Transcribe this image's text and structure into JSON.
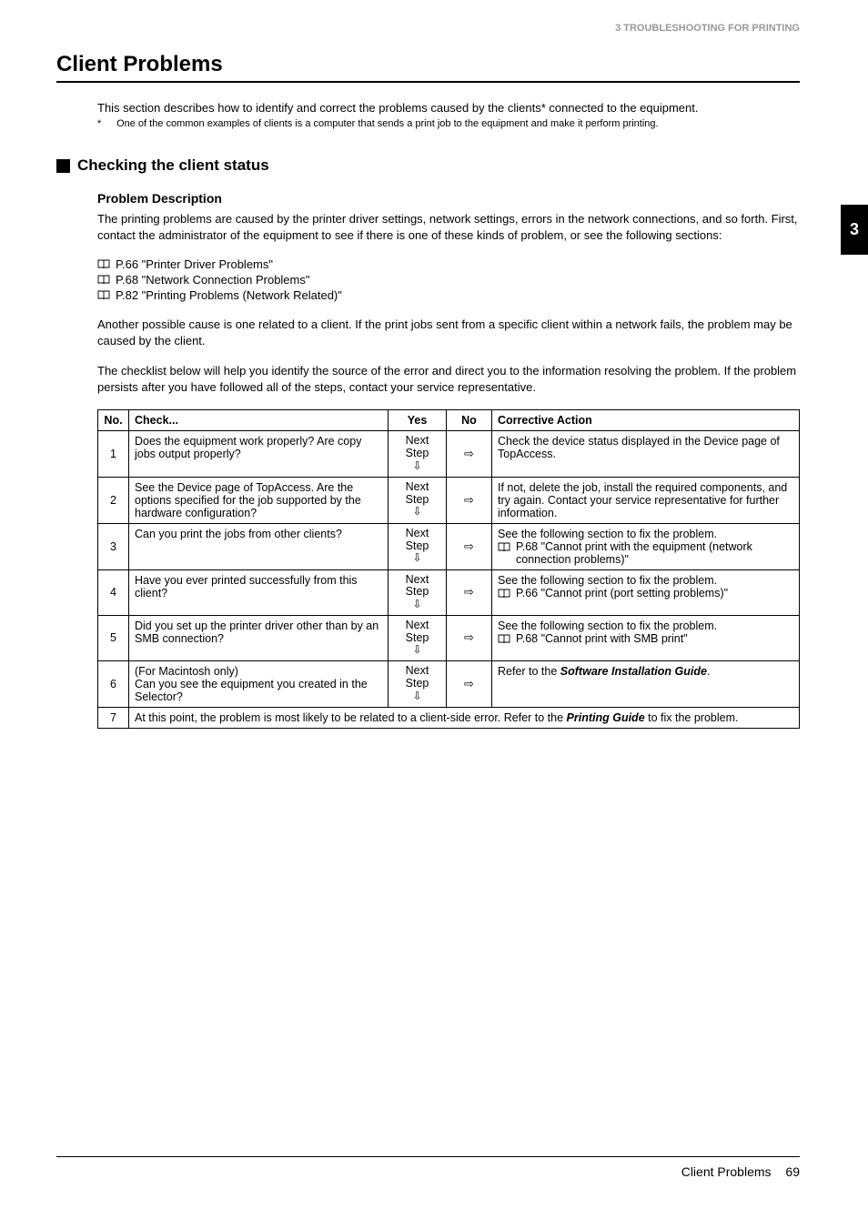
{
  "header": {
    "section": "3 TROUBLESHOOTING FOR PRINTING"
  },
  "title": "Client Problems",
  "intro": "This section describes how to identify and correct the problems caused by the clients* connected to the equipment.",
  "footnote": "One of the common examples of clients is a computer that sends a print job to the equipment and make it perform printing.",
  "section_heading": "Checking the client status",
  "sub_heading": "Problem Description",
  "para1": "The printing problems are caused by the printer driver settings, network settings, errors in the network connections, and so forth. First, contact the administrator of the equipment to see if there is one of these kinds of problem, or see the following sections:",
  "refs": [
    "P.66 \"Printer Driver Problems\"",
    "P.68 \"Network Connection Problems\"",
    "P.82 \"Printing Problems (Network Related)\""
  ],
  "para2": "Another possible cause is one related to a client. If the print jobs sent from a specific client within a network fails, the problem may be caused by the client.",
  "para3": "The checklist below will help you identify the source of the error and direct you to the information resolving the problem. If the problem persists after you have followed all of the steps, contact your service representative.",
  "table": {
    "headers": {
      "no": "No.",
      "check": "Check...",
      "yes": "Yes",
      "noCol": "No",
      "action": "Corrective Action"
    },
    "next_step": "Next Step",
    "rows": [
      {
        "no": "1",
        "check": "Does the equipment work properly? Are copy jobs output properly?",
        "action_text": "Check the device status displayed in the Device page of TopAccess.",
        "has_ref": false
      },
      {
        "no": "2",
        "check": "See the Device page of TopAccess. Are the options specified for the job supported by the hardware configuration?",
        "action_text": "If not, delete the job, install the required components, and try again. Contact your service representative for further information.",
        "has_ref": false
      },
      {
        "no": "3",
        "check": "Can you print the jobs from other clients?",
        "action_text": "See the following section to fix the problem.",
        "ref": "P.68 \"Cannot print with the equipment (network connection problems)\"",
        "has_ref": true
      },
      {
        "no": "4",
        "check": "Have you ever printed successfully from this client?",
        "action_text": "See the following section to fix the problem.",
        "ref": "P.66 \"Cannot print (port setting problems)\"",
        "has_ref": true
      },
      {
        "no": "5",
        "check": "Did you set up the printer driver other than by an SMB connection?",
        "action_text": "See the following section to fix the problem.",
        "ref": "P.68 \"Cannot print with SMB print\"",
        "has_ref": true
      },
      {
        "no": "6",
        "check": "(For Macintosh only)\nCan you see the equipment you created in the Selector?",
        "action_text_pre": "Refer to the ",
        "action_bold": "Software Installation Guide",
        "action_text_post": ".",
        "has_ref": false,
        "has_bold": true
      }
    ],
    "final_row": {
      "no": "7",
      "text_pre": "At this point, the problem is most likely to be related to a client-side error. Refer to the ",
      "bold": "Printing Guide",
      "text_post": " to fix the problem."
    }
  },
  "side_tab": "3",
  "footer": {
    "title": "Client Problems",
    "page": "69"
  }
}
